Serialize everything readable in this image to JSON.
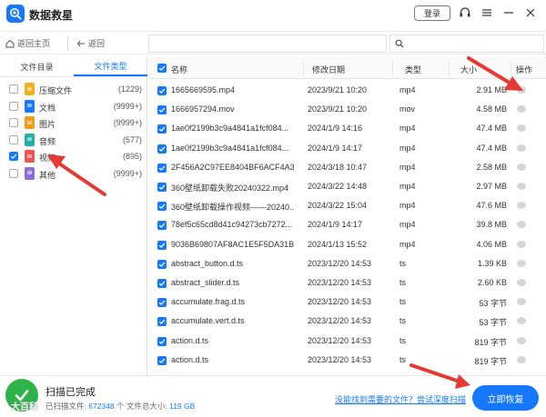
{
  "app": {
    "title": "数据救星",
    "login_label": "登录",
    "accent": "#1677ff"
  },
  "toolbar": {
    "home_label": "返回主页",
    "back_label": "返回"
  },
  "left_panel": {
    "tabs": [
      {
        "label": "文件目录",
        "active": false
      },
      {
        "label": "文件类型",
        "active": true
      }
    ],
    "types": [
      {
        "label": "压缩文件",
        "count": "(1229)",
        "checked": false,
        "color": "#f2b01e"
      },
      {
        "label": "文档",
        "count": "(9999+)",
        "checked": false,
        "color": "#1677ff"
      },
      {
        "label": "图片",
        "count": "(9999+)",
        "checked": false,
        "color": "#f29a1e"
      },
      {
        "label": "音频",
        "count": "(577)",
        "checked": false,
        "color": "#1fb0a4"
      },
      {
        "label": "视频",
        "count": "(895)",
        "checked": true,
        "color": "#ef5350"
      },
      {
        "label": "其他",
        "count": "(9999+)",
        "checked": false,
        "color": "#8c6cd9"
      }
    ]
  },
  "table": {
    "headers": {
      "name": "名称",
      "date": "修改日期",
      "type": "类型",
      "size": "大小",
      "op": "操作"
    },
    "rows": [
      {
        "name": "1665669595.mp4",
        "date": "2023/9/21 10:20",
        "type": "mp4",
        "size": "2.91 MB"
      },
      {
        "name": "1666957294.mov",
        "date": "2023/9/21 10:20",
        "type": "mov",
        "size": "4.58 MB"
      },
      {
        "name": "1ae0f2199b3c9a4841a1fcf084...",
        "date": "2024/1/9 14:16",
        "type": "mp4",
        "size": "47.4 MB"
      },
      {
        "name": "1ae0f2199b3c9a4841a1fcf084...",
        "date": "2024/1/9 14:17",
        "type": "mp4",
        "size": "47.4 MB"
      },
      {
        "name": "2F456A2C97EE8404BF6ACF4A3...",
        "date": "2024/3/18 10:47",
        "type": "mp4",
        "size": "2.58 MB"
      },
      {
        "name": "360壁纸卸载失败20240322.mp4",
        "date": "2024/3/22 14:48",
        "type": "mp4",
        "size": "2.97 MB"
      },
      {
        "name": "360壁纸卸载操作视频——20240...",
        "date": "2024/3/22 15:04",
        "type": "mp4",
        "size": "47.6 MB"
      },
      {
        "name": "78ef5c65cd8d41c94273cb7272...",
        "date": "2024/1/9 14:17",
        "type": "mp4",
        "size": "39.8 MB"
      },
      {
        "name": "9036B69807AF8AC1E5F5DA31B...",
        "date": "2024/1/13 15:52",
        "type": "mp4",
        "size": "4.06 MB"
      },
      {
        "name": "abstract_button.d.ts",
        "date": "2023/12/20 14:53",
        "type": "ts",
        "size": "1.39 KB"
      },
      {
        "name": "abstract_slider.d.ts",
        "date": "2023/12/20 14:53",
        "type": "ts",
        "size": "2.60 KB"
      },
      {
        "name": "accumulate.frag.d.ts",
        "date": "2023/12/20 14:53",
        "type": "ts",
        "size": "53 字节"
      },
      {
        "name": "accumulate.vert.d.ts",
        "date": "2023/12/20 14:53",
        "type": "ts",
        "size": "53 字节"
      },
      {
        "name": "action.d.ts",
        "date": "2023/12/20 14:53",
        "type": "ts",
        "size": "819 字节"
      },
      {
        "name": "action.d.ts",
        "date": "2023/12/20 14:53",
        "type": "ts",
        "size": "819 字节"
      }
    ]
  },
  "bottom": {
    "status_title": "扫描已完成",
    "files_label": "已扫描文件:",
    "files_count": "672348",
    "size_label": "个 文件总大小:",
    "size_value": "119 GB",
    "watermark": "大百科",
    "help_link": "没能找到需要的文件？尝试深度扫描",
    "recover_label": "立即恢复"
  }
}
